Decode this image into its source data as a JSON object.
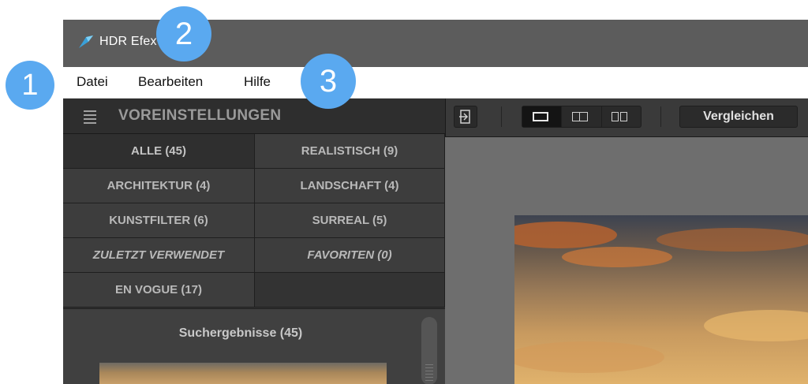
{
  "window": {
    "title": "HDR Efex Pro 2"
  },
  "menu": {
    "items": [
      "Datei",
      "Bearbeiten",
      "Hilfe"
    ]
  },
  "presets": {
    "header": "VOREINSTELLUNGEN",
    "categories": [
      "ALLE (45)",
      "REALISTISCH (9)",
      "ARCHITEKTUR (4)",
      "LANDSCHAFT (4)",
      "KUNSTFILTER (6)",
      "SURREAL (5)",
      "ZULETZT VERWENDET",
      "FAVORITEN (0)",
      "EN VOGUE (17)"
    ],
    "active_category": "ALLE (45)",
    "results_title": "Suchergebnisse (45)"
  },
  "toolbar": {
    "compare_label": "Vergleichen",
    "view_modes": [
      "single-view",
      "split-view",
      "side-by-side-view"
    ],
    "active_view": "single-view"
  },
  "callouts": [
    "1",
    "2",
    "3"
  ],
  "colors": {
    "callout": "#5aa9f0",
    "titlebar": "#5c5c5c",
    "panel": "#333333"
  }
}
